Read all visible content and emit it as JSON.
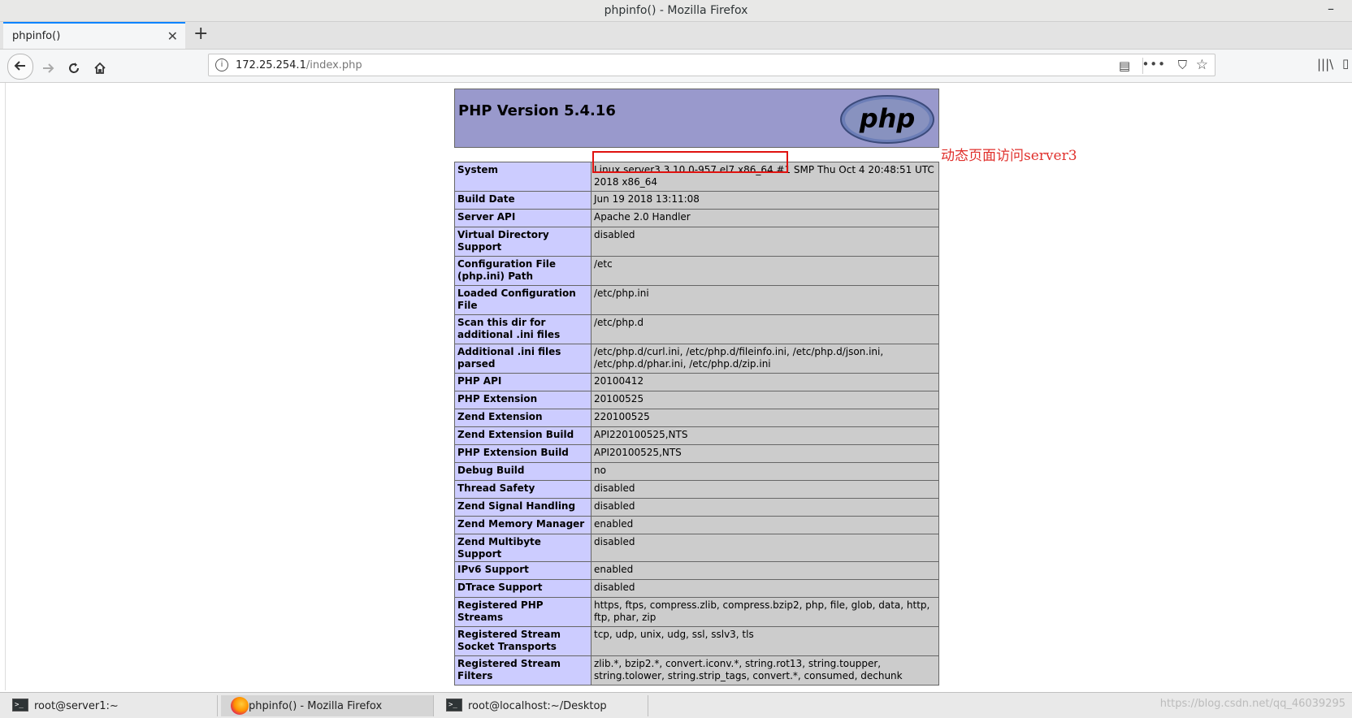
{
  "window": {
    "title": "phpinfo() - Mozilla Firefox",
    "minimize_glyph": "–"
  },
  "tabs": [
    {
      "label": "phpinfo()",
      "close_glyph": "✕"
    }
  ],
  "new_tab_glyph": "+",
  "navbar": {
    "back_icon": "arrow-left-icon",
    "forward_icon": "arrow-right-icon",
    "reload_icon": "reload-icon",
    "home_icon": "home-icon",
    "url_host": "172.25.254.1",
    "url_path": "/index.php"
  },
  "php": {
    "version_title": "PHP Version 5.4.16",
    "logo_text": "php",
    "rows": [
      {
        "label": "System",
        "value": "Linux server3 3.10.0-957.el7.x86_64 #1 SMP Thu Oct 4 20:48:51 UTC 2018 x86_64"
      },
      {
        "label": "Build Date",
        "value": "Jun 19 2018 13:11:08"
      },
      {
        "label": "Server API",
        "value": "Apache 2.0 Handler"
      },
      {
        "label": "Virtual Directory Support",
        "value": "disabled"
      },
      {
        "label": "Configuration File (php.ini) Path",
        "value": "/etc"
      },
      {
        "label": "Loaded Configuration File",
        "value": "/etc/php.ini"
      },
      {
        "label": "Scan this dir for additional .ini files",
        "value": "/etc/php.d"
      },
      {
        "label": "Additional .ini files parsed",
        "value": "/etc/php.d/curl.ini, /etc/php.d/fileinfo.ini, /etc/php.d/json.ini, /etc/php.d/phar.ini, /etc/php.d/zip.ini"
      },
      {
        "label": "PHP API",
        "value": "20100412"
      },
      {
        "label": "PHP Extension",
        "value": "20100525"
      },
      {
        "label": "Zend Extension",
        "value": "220100525"
      },
      {
        "label": "Zend Extension Build",
        "value": "API220100525,NTS"
      },
      {
        "label": "PHP Extension Build",
        "value": "API20100525,NTS"
      },
      {
        "label": "Debug Build",
        "value": "no"
      },
      {
        "label": "Thread Safety",
        "value": "disabled"
      },
      {
        "label": "Zend Signal Handling",
        "value": "disabled"
      },
      {
        "label": "Zend Memory Manager",
        "value": "enabled"
      },
      {
        "label": "Zend Multibyte Support",
        "value": "disabled"
      },
      {
        "label": "IPv6 Support",
        "value": "enabled"
      },
      {
        "label": "DTrace Support",
        "value": "disabled"
      },
      {
        "label": "Registered PHP Streams",
        "value": "https, ftps, compress.zlib, compress.bzip2, php, file, glob, data, http, ftp, phar, zip"
      },
      {
        "label": "Registered Stream Socket Transports",
        "value": "tcp, udp, unix, udg, ssl, sslv3, tls"
      },
      {
        "label": "Registered Stream Filters",
        "value": "zlib.*, bzip2.*, convert.iconv.*, string.rot13, string.toupper, string.tolower, string.strip_tags, convert.*, consumed, dechunk"
      }
    ]
  },
  "annotation": {
    "text": "动态页面访问server3",
    "color": "#e0302c"
  },
  "taskbar": {
    "items": [
      {
        "label": "root@server1:~",
        "icon": "terminal-icon"
      },
      {
        "label": "phpinfo() - Mozilla Firefox",
        "icon": "firefox-icon"
      },
      {
        "label": "root@localhost:~/Desktop",
        "icon": "terminal-icon"
      }
    ],
    "watermark": "https://blog.csdn.net/qq_46039295"
  }
}
